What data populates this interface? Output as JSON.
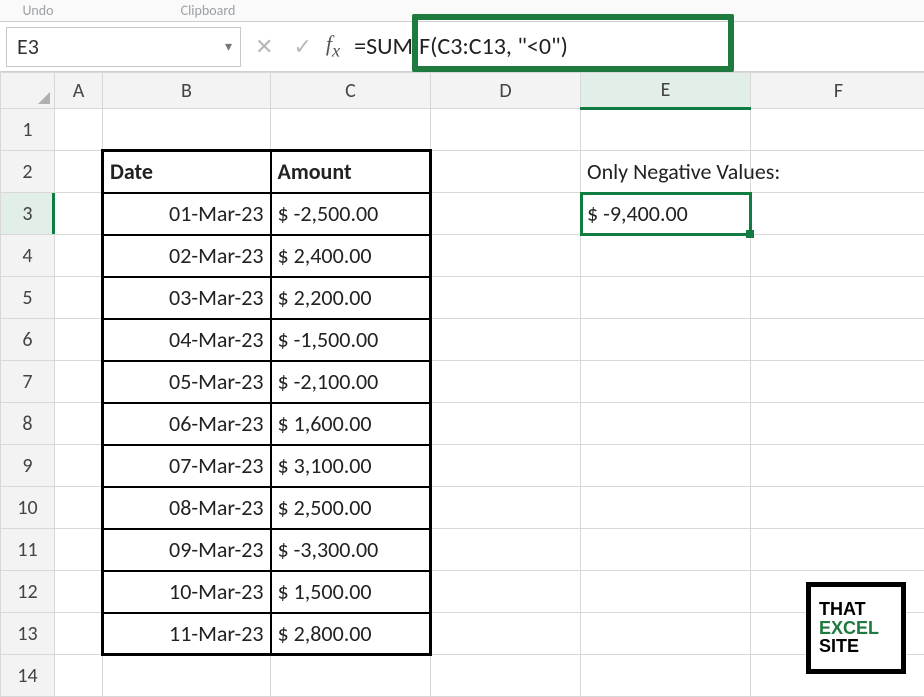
{
  "ribbon": {
    "undo": "Undo",
    "clipboard": "Clipboard"
  },
  "namebox": {
    "value": "E3"
  },
  "formula": "=SUMIF(C3:C13, \"<0\")",
  "columns": [
    "A",
    "B",
    "C",
    "D",
    "E",
    "F"
  ],
  "row_numbers": [
    "1",
    "2",
    "3",
    "4",
    "5",
    "6",
    "7",
    "8",
    "9",
    "10",
    "11",
    "12",
    "13",
    "14"
  ],
  "table": {
    "headers": {
      "date": "Date",
      "amount": "Amount"
    },
    "rows": [
      {
        "date": "01-Mar-23",
        "amount": "$ -2,500.00"
      },
      {
        "date": "02-Mar-23",
        "amount": "$  2,400.00"
      },
      {
        "date": "03-Mar-23",
        "amount": "$  2,200.00"
      },
      {
        "date": "04-Mar-23",
        "amount": "$ -1,500.00"
      },
      {
        "date": "05-Mar-23",
        "amount": "$ -2,100.00"
      },
      {
        "date": "06-Mar-23",
        "amount": "$  1,600.00"
      },
      {
        "date": "07-Mar-23",
        "amount": "$  3,100.00"
      },
      {
        "date": "08-Mar-23",
        "amount": "$  2,500.00"
      },
      {
        "date": "09-Mar-23",
        "amount": "$ -3,300.00"
      },
      {
        "date": "10-Mar-23",
        "amount": "$  1,500.00"
      },
      {
        "date": "11-Mar-23",
        "amount": "$  2,800.00"
      }
    ]
  },
  "side": {
    "label": "Only Negative Values:",
    "result": "$  -9,400.00"
  },
  "logo": {
    "l1": "THAT",
    "l2": "EXCEL",
    "l3": "SITE"
  }
}
